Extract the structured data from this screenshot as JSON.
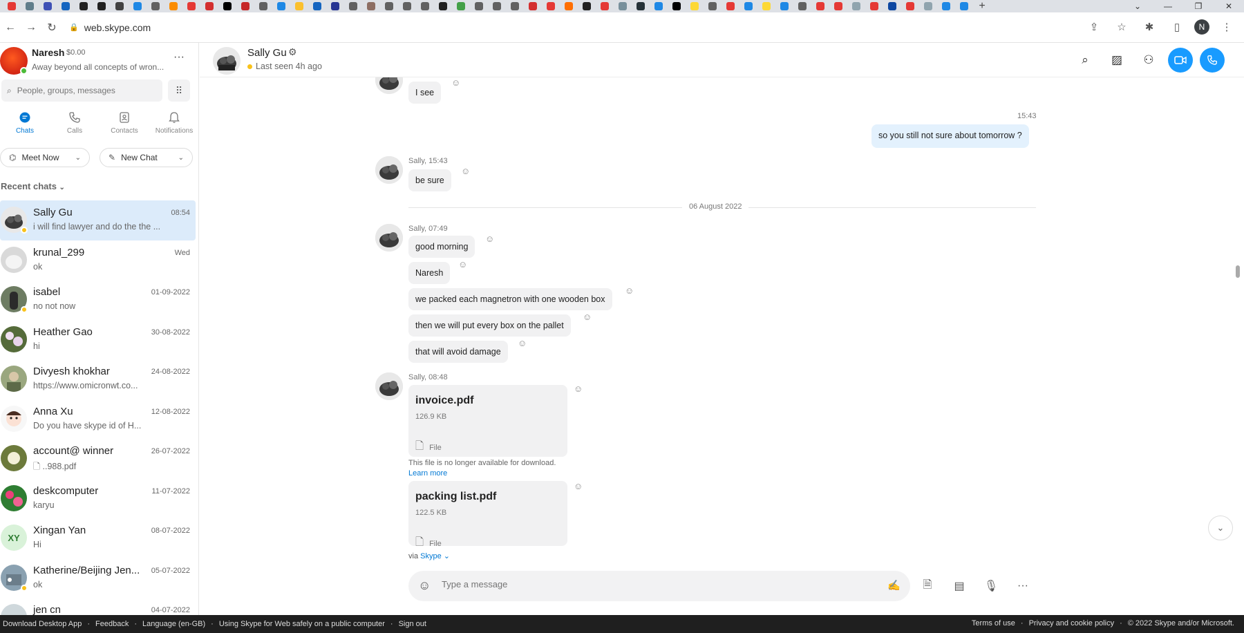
{
  "browser": {
    "url": "web.skype.com",
    "profile_initial": "N"
  },
  "me": {
    "name": "Naresh",
    "credit": "$0.00",
    "status": "Away beyond all concepts of wron..."
  },
  "search": {
    "placeholder": "People, groups, messages"
  },
  "nav": {
    "chats": "Chats",
    "calls": "Calls",
    "contacts": "Contacts",
    "notifications": "Notifications"
  },
  "actions": {
    "meet_now": "Meet Now",
    "new_chat": "New Chat"
  },
  "recent_header": "Recent chats",
  "chats": [
    {
      "name": "Sally Gu",
      "preview": "i will find lawyer and do the the ...",
      "time": "08:54"
    },
    {
      "name": "krunal_299",
      "preview": "ok",
      "time": "Wed"
    },
    {
      "name": "isabel",
      "preview": "no not now",
      "time": "01-09-2022"
    },
    {
      "name": "Heather Gao",
      "preview": "hi",
      "time": "30-08-2022"
    },
    {
      "name": "Divyesh khokhar",
      "preview": "https://www.omicronwt.co...",
      "time": "24-08-2022"
    },
    {
      "name": "Anna Xu",
      "preview": "Do you have skype id of H...",
      "time": "12-08-2022"
    },
    {
      "name": "account@ winner",
      "preview": "..988.pdf",
      "time": "26-07-2022"
    },
    {
      "name": "deskcomputer",
      "preview": "karyu",
      "time": "11-07-2022"
    },
    {
      "name": "Xingan  Yan",
      "preview": "Hi",
      "time": "08-07-2022",
      "initials": "XY"
    },
    {
      "name": "Katherine/Beijing Jen...",
      "preview": "ok",
      "time": "05-07-2022"
    },
    {
      "name": "jen cn",
      "preview": "",
      "time": "04-07-2022"
    }
  ],
  "header": {
    "name": "Sally Gu",
    "status": "Last seen 4h ago"
  },
  "messages": {
    "m1": "I see",
    "t_me": "15:43",
    "m_me": "so you still not sure about tomorrow ?",
    "meta2": "Sally, 15:43",
    "m2": "be sure",
    "date_divider": "06 August 2022",
    "meta3": "Sally, 07:49",
    "m3a": "good morning",
    "m3b": "Naresh",
    "m3c": "we packed each magnetron with one wooden box",
    "m3d": "then we will put every box on the pallet",
    "m3e": "that will avoid damage",
    "meta4": "Sally, 08:48",
    "file1": {
      "name": "invoice.pdf",
      "size": "126.9 KB",
      "kind": "File"
    },
    "unavailable": "This file is no longer available for download.",
    "learn_more": "Learn more",
    "file2": {
      "name": "packing list.pdf",
      "size": "122.5 KB",
      "kind": "File"
    }
  },
  "via": {
    "prefix": "via",
    "app": "Skype"
  },
  "composer": {
    "placeholder": "Type a message"
  },
  "footer": {
    "left": [
      "Download Desktop App",
      "Feedback",
      "Language (en-GB)",
      "Using Skype for Web safely on a public computer",
      "Sign out"
    ],
    "right": [
      "Terms of use",
      "Privacy and cookie policy",
      "© 2022 Skype and/or Microsoft."
    ]
  },
  "colors": {
    "accent": "#0078d4",
    "call_blue": "#199bff",
    "away": "#f9c21b",
    "online": "#4cbb3a"
  }
}
